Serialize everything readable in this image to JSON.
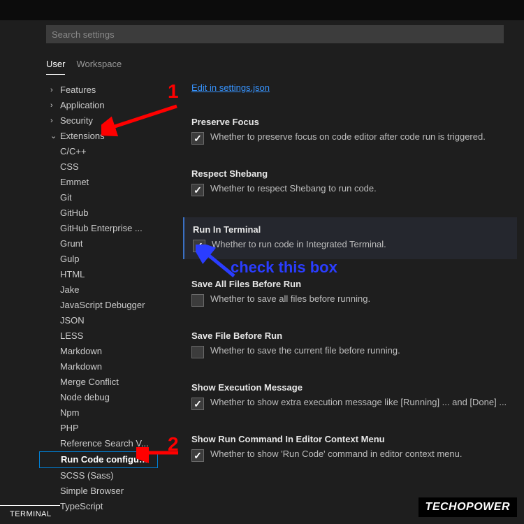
{
  "search": {
    "placeholder": "Search settings"
  },
  "tabs": {
    "user": "User",
    "workspace": "Workspace"
  },
  "tree": {
    "features": "Features",
    "application": "Application",
    "security": "Security",
    "extensions": "Extensions",
    "items": [
      "C/C++",
      "CSS",
      "Emmet",
      "Git",
      "GitHub",
      "GitHub Enterprise ...",
      "Grunt",
      "Gulp",
      "HTML",
      "Jake",
      "JavaScript Debugger",
      "JSON",
      "LESS",
      "Markdown",
      "Markdown",
      "Merge Conflict",
      "Node debug",
      "Npm",
      "PHP",
      "Reference Search V...",
      "Run Code configu…",
      "SCSS (Sass)",
      "Simple Browser",
      "TypeScript"
    ]
  },
  "panel": {
    "editJsonLink": "Edit in settings.json",
    "preserveFocus": {
      "title": "Preserve Focus",
      "desc": "Whether to preserve focus on code editor after code run is triggered.",
      "checked": true
    },
    "respectShebang": {
      "title": "Respect Shebang",
      "desc": "Whether to respect Shebang to run code.",
      "checked": true
    },
    "runInTerminal": {
      "title": "Run In Terminal",
      "desc": "Whether to run code in Integrated Terminal.",
      "checked": true
    },
    "saveAllBeforeRun": {
      "title": "Save All Files Before Run",
      "desc": "Whether to save all files before running.",
      "checked": false
    },
    "saveFileBeforeRun": {
      "title": "Save File Before Run",
      "desc": "Whether to save the current file before running.",
      "checked": false
    },
    "showExecMsg": {
      "title": "Show Execution Message",
      "desc": "Whether to show extra execution message like [Running] ... and [Done] ...",
      "checked": true
    },
    "showRunContextMenu": {
      "title": "Show Run Command In Editor Context Menu",
      "desc": "Whether to show 'Run Code' command in editor context menu.",
      "checked": true
    }
  },
  "bottomTab": "TERMINAL",
  "watermark": "TECHOPOWER",
  "annotations": {
    "n1": "1",
    "n2": "2",
    "check": "check this box"
  }
}
